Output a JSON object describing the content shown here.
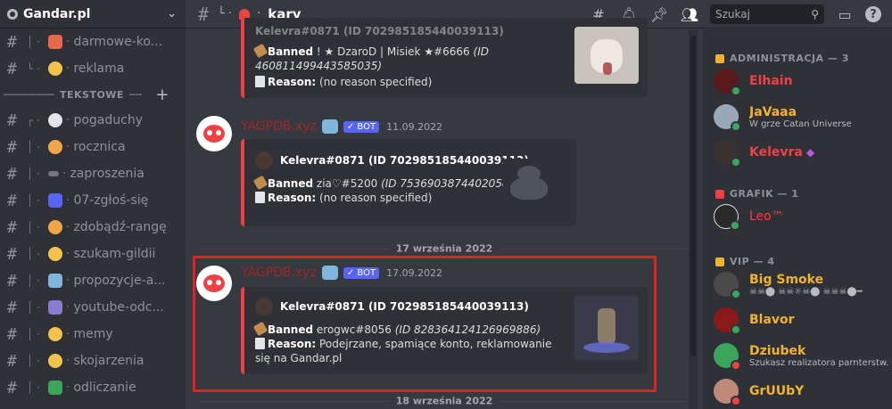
{
  "guild": {
    "name": "Gandar.pl"
  },
  "sidebar": {
    "channels_top": [
      {
        "label": "darmowe-ko..."
      },
      {
        "label": "reklama"
      }
    ],
    "category": "TEKSTOWE",
    "channels": [
      {
        "label": "pogaduchy"
      },
      {
        "label": "rocznica"
      },
      {
        "label": "zaproszenia"
      },
      {
        "label": "07-zgłoś-się"
      },
      {
        "label": "zdobądź-rangę"
      },
      {
        "label": "szukam-gildii"
      },
      {
        "label": "propozycje-a..."
      },
      {
        "label": "youtube-odc..."
      },
      {
        "label": "memy"
      },
      {
        "label": "skojarzenia"
      },
      {
        "label": "odliczanie"
      }
    ]
  },
  "topbar": {
    "channel_name": "kary",
    "search_placeholder": "Szukaj"
  },
  "chat": {
    "embed0": {
      "author": "Kelevra#0871 (ID 702985185440039113)",
      "banned_label": "Banned",
      "banned_user": "! ★ DzaroD | Misiek ★#6666",
      "banned_id": "(ID 460811499443585035)",
      "reason_label": "Reason:",
      "reason_text": "(no reason specified)"
    },
    "messages": [
      {
        "username": "YAGPDB.xyz",
        "bot_tag": "✓ BOT",
        "timestamp": "11.09.2022",
        "author": "Kelevra#0871 (ID 702985185440039113)",
        "banned_label": "Banned",
        "banned_user": "zia♡#5200",
        "banned_id": "(ID 753690387440205825)",
        "reason_label": "Reason:",
        "reason_text": "(no reason specified)"
      },
      {
        "username": "YAGPDB.xyz",
        "bot_tag": "✓ BOT",
        "timestamp": "17.09.2022",
        "author": "Kelevra#0871 (ID 702985185440039113)",
        "banned_label": "Banned",
        "banned_user": "erogwc#8056",
        "banned_id": "(ID 828364124126969886)",
        "reason_label": "Reason:",
        "reason_text": "Podejrzane, spamiące konto, reklamowanie się na Gandar.pl"
      }
    ],
    "dividers": [
      "17 września 2022",
      "18 września 2022"
    ]
  },
  "members": {
    "roles": [
      {
        "label": "ADMINISTRACJA — 3",
        "color": "#f0b232"
      },
      {
        "label": "GRAFIK — 1",
        "color": "#ed4245"
      },
      {
        "label": "VIP — 4",
        "color": "#f0b232"
      }
    ],
    "list": [
      {
        "name": "Elhain",
        "activity": "",
        "color": "#ed4245",
        "status": "#3ba55c"
      },
      {
        "name": "JaVaaa",
        "activity": "W grze Catan Universe",
        "color": "#f0b232",
        "status": "#3ba55c"
      },
      {
        "name": "Kelevra",
        "activity": "",
        "color": "#ed4245",
        "status": "#3ba55c"
      },
      {
        "name": "Leo™",
        "activity": "",
        "color": "#ed4245",
        "status": "#3ba55c"
      },
      {
        "name": "Big Smoke",
        "activity": "☠︎☠︎⬤ ☠︎☠︎☼☠︎⬤ ☠︎☠︎☠︎⬤━",
        "color": "#f0b232",
        "status": "#3ba55c"
      },
      {
        "name": "Blavor",
        "activity": "",
        "color": "#f0b232",
        "status": "#3ba55c"
      },
      {
        "name": "Dziubek",
        "activity": "Szukasz realizatora parnterstw...",
        "color": "#f0b232",
        "status": "#ed4245"
      },
      {
        "name": "GrUUbY",
        "activity": "",
        "color": "#f0b232",
        "status": "#ed4245"
      }
    ]
  }
}
